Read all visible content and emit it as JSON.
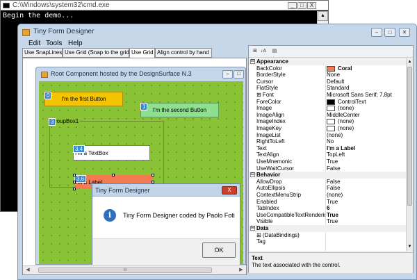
{
  "cmd": {
    "title": "C:\\Windows\\system32\\cmd.exe",
    "text": "Begin the demo...",
    "minimize": "_",
    "maximize": "□",
    "close": "X",
    "scroll_up": "▲"
  },
  "main": {
    "title": "Tiny Form Designer",
    "minimize": "–",
    "maximize": "□",
    "close": "✕",
    "menu": [
      "Edit",
      "Tools",
      "Help"
    ]
  },
  "tabs": [
    {
      "label": "Use SnapLines",
      "active": false
    },
    {
      "label": "Use Grid (Snap to the grid)",
      "active": false
    },
    {
      "label": "Use Grid",
      "active": true
    },
    {
      "label": "Align control by hand",
      "active": false
    }
  ],
  "root_window": {
    "title": "Root Component hosted by the DesignSurface N.3",
    "minimize": "–",
    "maximize": "□"
  },
  "controls": {
    "button1": {
      "index": "0",
      "text": "I'm the first Button"
    },
    "button2": {
      "index": "1",
      "text": "I'm the second Button"
    },
    "groupbox": {
      "index": "3",
      "text": "roupBox1"
    },
    "textbox": {
      "index": "3,4",
      "text": "I'm a TextBox"
    },
    "label": {
      "index": "3,6",
      "text": "I'm a Label"
    }
  },
  "dialog": {
    "title": "Tiny Form Designer",
    "close": "X",
    "icon": "i",
    "message": "Tiny Form Designer coded by Paolo Foti",
    "ok": "OK"
  },
  "scroll": {
    "left": "◀",
    "right": "▶",
    "thumb": "III"
  },
  "property_grid": {
    "toolbar": [
      "⊞",
      "↓A",
      "▤"
    ],
    "rows": [
      {
        "kind": "category",
        "toggle": "⊟",
        "name": "Appearance"
      },
      {
        "name": "BackColor",
        "value": "Coral",
        "swatch": "#f47a52",
        "bold": true
      },
      {
        "name": "BorderStyle",
        "value": "None"
      },
      {
        "name": "Cursor",
        "value": "Default"
      },
      {
        "name": "FlatStyle",
        "value": "Standard"
      },
      {
        "name": "⊞ Font",
        "value": "Microsoft Sans Serif; 7,8pt"
      },
      {
        "name": "ForeColor",
        "value": "ControlText",
        "swatch": "#000000"
      },
      {
        "name": "Image",
        "value": "(none)",
        "swatch": "#ffffff"
      },
      {
        "name": "ImageAlign",
        "value": "MiddleCenter"
      },
      {
        "name": "ImageIndex",
        "value": "(none)",
        "swatch": "#ffffff"
      },
      {
        "name": "ImageKey",
        "value": "(none)",
        "swatch": "#ffffff"
      },
      {
        "name": "ImageList",
        "value": "(none)"
      },
      {
        "name": "RightToLeft",
        "value": "No"
      },
      {
        "name": "Text",
        "value": "I'm a Label",
        "bold": true
      },
      {
        "name": "TextAlign",
        "value": "TopLeft"
      },
      {
        "name": "UseMnemonic",
        "value": "True"
      },
      {
        "name": "UseWaitCursor",
        "value": "False"
      },
      {
        "kind": "category",
        "toggle": "⊟",
        "name": "Behavior"
      },
      {
        "name": "AllowDrop",
        "value": "False"
      },
      {
        "name": "AutoEllipsis",
        "value": "False"
      },
      {
        "name": "ContextMenuStrip",
        "value": "(none)"
      },
      {
        "name": "Enabled",
        "value": "True"
      },
      {
        "name": "TabIndex",
        "value": "6",
        "bold": true
      },
      {
        "name": "UseCompatibleTextRendering",
        "value": "True",
        "bold": true
      },
      {
        "name": "Visible",
        "value": "True"
      },
      {
        "kind": "category",
        "toggle": "⊟",
        "name": "Data"
      },
      {
        "name": "⊞ (DataBindings)",
        "value": ""
      },
      {
        "name": "Tag",
        "value": ""
      }
    ],
    "description_title": "Text",
    "description_text": "The text associated with the control.",
    "scroll_up": "▲",
    "scroll_down": "▼"
  }
}
